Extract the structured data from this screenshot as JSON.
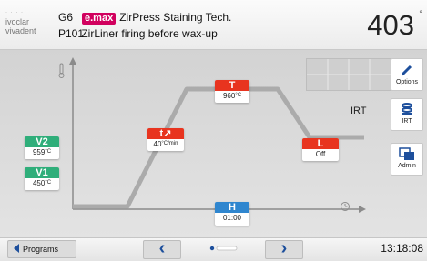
{
  "header": {
    "logo_line1": "ivoclar",
    "logo_line2": "vivadent",
    "slot": "G6",
    "brand": "e.max",
    "program_name": "ZirPress Staining Tech.",
    "program_no": "P101",
    "program_desc": "ZirLiner firing before wax-up",
    "temperature": "403",
    "temp_unit": "°"
  },
  "chart": {
    "thermometer_icon": "thermometer-icon",
    "clock_icon": "clock-icon",
    "steps": {
      "v2": {
        "label": "V2",
        "value": "959",
        "unit": "°C"
      },
      "v1": {
        "label": "V1",
        "value": "450",
        "unit": "°C"
      },
      "t_rate": {
        "label": "t↗",
        "value": "40",
        "unit": "°C/min"
      },
      "T": {
        "label": "T",
        "value": "960",
        "unit": "°C"
      },
      "L": {
        "label": "L",
        "value": "Off"
      },
      "H": {
        "label": "H",
        "value": "01:00"
      }
    }
  },
  "side": {
    "options_label": "Options",
    "irt_text": "IRT",
    "irt_button_label": "IRT",
    "admin_label": "Admin"
  },
  "footer": {
    "programs_label": "Programs",
    "prev_icon": "chevron-left-icon",
    "next_icon": "chevron-right-icon",
    "time": "13:18:08"
  },
  "colors": {
    "red": "#e8341f",
    "green": "#2fae7a",
    "blue": "#2f86cf",
    "brand": "#d1005e",
    "nav_blue": "#1d4f9c"
  }
}
